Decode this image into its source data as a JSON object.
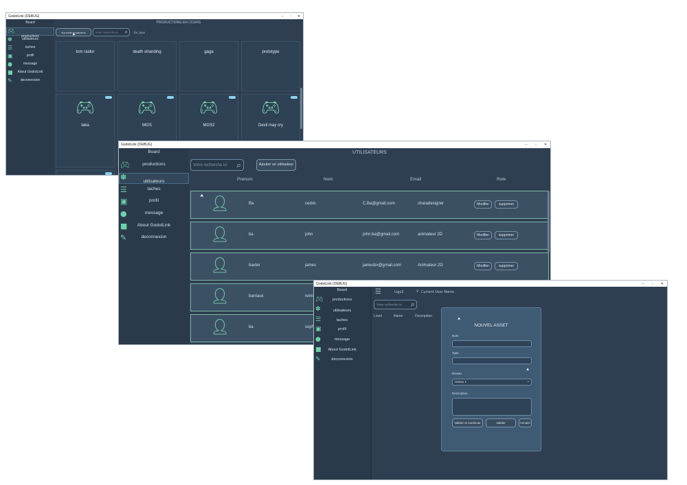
{
  "windows": {
    "productions": {
      "title": "GodotLink (DEBUG)",
      "header": "PRODUCTIONS EN COURS",
      "new_button": "Nouvelle production",
      "search_placeholder": "Votre recherche ici",
      "filter_label": "Ex: jeux",
      "sidebar": [
        "Board",
        "productions",
        "utilisateurs",
        "taches",
        "profil",
        "message",
        "About GodotLink",
        "deconnexion"
      ],
      "cards": [
        "tom raidor",
        "death stranding",
        "gaga",
        "prototype",
        "taka",
        "MGS",
        "MGS2",
        "Devil may cry"
      ]
    },
    "users": {
      "title": "GodotLink (DEBUG)",
      "header": "UTILISATEURS",
      "search_placeholder": "Votre recherche ici",
      "add_button": "Ajouter un utilisateur",
      "sidebar": [
        "Board",
        "productions",
        "utilisateurs",
        "taches",
        "profil",
        "message",
        "About GodotLink",
        "deconnexion"
      ],
      "columns": [
        "Prenom",
        "Nom",
        "Email",
        "Role"
      ],
      "modify_label": "Modifier",
      "delete_label": "supprimer",
      "rows": [
        {
          "prenom": "Ba",
          "nom": "cedric",
          "email": "C.Ba@gmail.com",
          "role": "charadesigner"
        },
        {
          "prenom": "ba",
          "nom": "john",
          "email": "john.ba@gmail.com",
          "role": "animateur 2D"
        },
        {
          "prenom": "baxter",
          "nom": "james",
          "email": "jamesbx@gmail.com",
          "role": "Animateur 2D"
        },
        {
          "prenom": "barriaux",
          "nom": "remi",
          "email": "",
          "role": ""
        },
        {
          "prenom": "ba",
          "nom": "sophi",
          "email": "",
          "role": ""
        }
      ]
    },
    "assets": {
      "title": "GodotLink (DEBUG)",
      "sidebar": [
        "Board",
        "productions",
        "utilisateurs",
        "taches",
        "profil",
        "message",
        "About GodotLink",
        "deconnexion"
      ],
      "topbar_label": "Ligo2",
      "current_user": "Current User Name",
      "search_placeholder": "Votre recherche ici",
      "columns": [
        "Level",
        "Name",
        "Description"
      ],
      "dialog": {
        "title": "NOUVEL ASSET",
        "name_label": "Nom",
        "type_label": "Type",
        "level_label": "Niveau",
        "level_value": "niveau 1",
        "description_label": "Description",
        "btn_validate_continue": "Valider et continuer",
        "btn_validate": "Valider",
        "btn_cancel": "Annuler"
      }
    }
  },
  "window_controls": [
    "–",
    "▫",
    "✕"
  ],
  "icons": {
    "sidebar": [
      "gamepad-icon",
      "users-icon",
      "tasks-icon",
      "profile-icon",
      "message-icon",
      "info-icon",
      "logout-icon"
    ],
    "search": "search-icon",
    "avatar": "user-avatar-icon",
    "menu": "hamburger-menu-icon"
  },
  "colors": {
    "background": "#2f3f51",
    "sidebar": "#2b3a4b",
    "accent": "#6fd1a8",
    "row_border": "#7fb8a3",
    "dialog": "#3f5a73"
  }
}
